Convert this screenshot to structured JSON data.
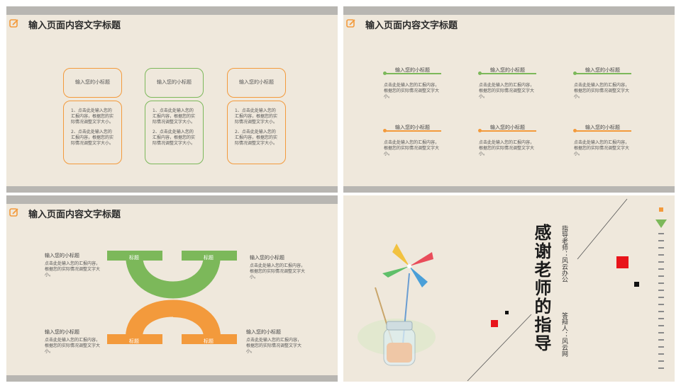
{
  "colors": {
    "orange": "#f39a3c",
    "green": "#7cb85a",
    "red": "#e8141b",
    "bg": "#efe8dc",
    "bar": "#b8b6b2"
  },
  "header_title": "输入页面内容文字标题",
  "slide1": {
    "cards": [
      {
        "title": "输入您的小标题",
        "color": "orange",
        "items": [
          "1、点击此处输入您的汇报内容，根据您的实际情况调整文字大小。",
          "2、点击此处输入您的汇报内容，根据您的实际情况调整文字大小。"
        ]
      },
      {
        "title": "输入您的小标题",
        "color": "green",
        "items": [
          "1、点击此处输入您的汇报内容，根据您的实际情况调整文字大小。",
          "2、点击此处输入您的汇报内容，根据您的实际情况调整文字大小。"
        ]
      },
      {
        "title": "输入您的小标题",
        "color": "orange",
        "items": [
          "1、点击此处输入您的汇报内容，根据您的实际情况调整文字大小。",
          "2、点击此处输入您的汇报内容，根据您的实际情况调整文字大小。"
        ]
      }
    ]
  },
  "slide2": {
    "items": [
      {
        "title": "输入您的小标题",
        "color": "green",
        "desc": "点击此处输入您的汇报内容，根据您的实际情况调整文字大小。"
      },
      {
        "title": "输入您的小标题",
        "color": "green",
        "desc": "点击此处输入您的汇报内容，根据您的实际情况调整文字大小。"
      },
      {
        "title": "输入您的小标题",
        "color": "green",
        "desc": "点击此处输入您的汇报内容，根据您的实际情况调整文字大小。"
      },
      {
        "title": "输入您的小标题",
        "color": "orange",
        "desc": "点击此处输入您的汇报内容，根据您的实际情况调整文字大小。"
      },
      {
        "title": "输入您的小标题",
        "color": "orange",
        "desc": "点击此处输入您的汇报内容，根据您的实际情况调整文字大小。"
      },
      {
        "title": "输入您的小标题",
        "color": "orange",
        "desc": "点击此处输入您的汇报内容，根据您的实际情况调整文字大小。"
      }
    ]
  },
  "slide3": {
    "labels": [
      "标题",
      "标题",
      "标题",
      "标题"
    ],
    "blocks": [
      {
        "title": "输入您的小标题",
        "desc": "点击此处输入您的汇报内容，根据您的实际情况调整文字大小。"
      },
      {
        "title": "输入您的小标题",
        "desc": "点击此处输入您的汇报内容，根据您的实际情况调整文字大小。"
      },
      {
        "title": "输入您的小标题",
        "desc": "点击此处输入您的汇报内容，根据您的实际情况调整文字大小。"
      },
      {
        "title": "输入您的小标题",
        "desc": "点击此处输入您的汇报内容，根据您的实际情况调整文字大小。"
      }
    ]
  },
  "slide4": {
    "title": "感谢老师的指导",
    "advisor": "指导老师：风云办公",
    "defender": "答辩人：风云网"
  }
}
